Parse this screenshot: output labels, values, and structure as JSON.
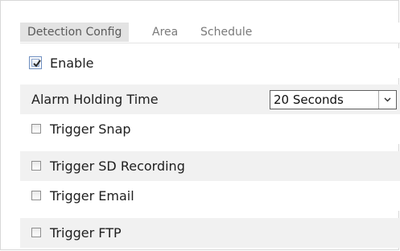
{
  "tabs": [
    {
      "label": "Detection Config",
      "active": true
    },
    {
      "label": "Area",
      "active": false
    },
    {
      "label": "Schedule",
      "active": false
    }
  ],
  "enable": {
    "label": "Enable",
    "checked": true
  },
  "alarm_holding": {
    "label": "Alarm Holding Time",
    "selected": "20 Seconds"
  },
  "triggers": [
    {
      "label": "Trigger Snap",
      "checked": false
    },
    {
      "label": "Trigger SD Recording",
      "checked": false
    },
    {
      "label": "Trigger Email",
      "checked": false
    },
    {
      "label": "Trigger FTP",
      "checked": false
    }
  ],
  "colors": {
    "active_tab_bg": "#e3e3e3",
    "row_shade": "#f1f1f1",
    "text": "#202020"
  }
}
